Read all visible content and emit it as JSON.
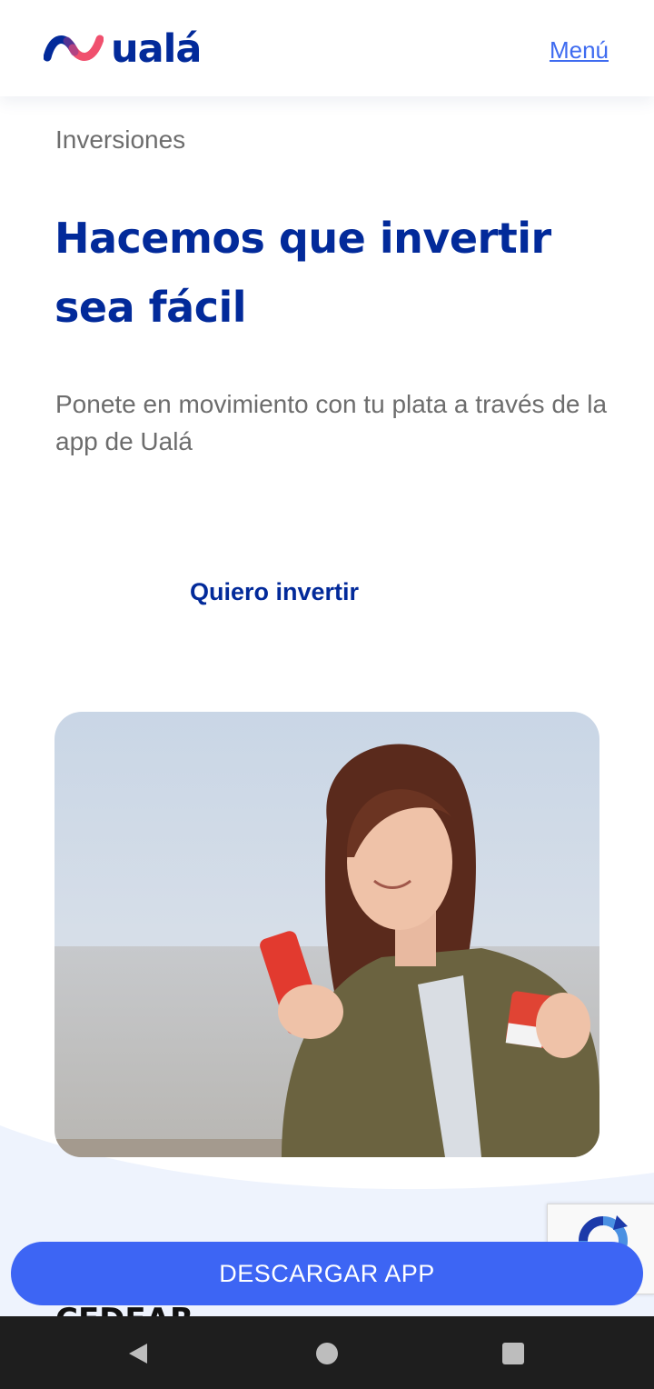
{
  "header": {
    "brand": "ualá",
    "menu_label": "Menú"
  },
  "hero": {
    "eyebrow": "Inversiones",
    "title": "Hacemos que invertir sea fácil",
    "subtitle": "Ponete en movimiento con tu plata a través de la app de Ualá",
    "cta_label": "Quiero invertir"
  },
  "next_section": {
    "title": "CEDEAR"
  },
  "floating_cta": {
    "label": "DESCARGAR APP"
  },
  "colors": {
    "brand_navy": "#022a9a",
    "brand_blue": "#3d65f4",
    "brand_coral": "#f0506e",
    "wave_bg": "#eef3fd"
  },
  "icons": {
    "logo": "uala-wave-logo",
    "recaptcha": "recaptcha-icon",
    "back": "back-triangle-icon",
    "home": "home-circle-icon",
    "recents": "recents-square-icon"
  }
}
